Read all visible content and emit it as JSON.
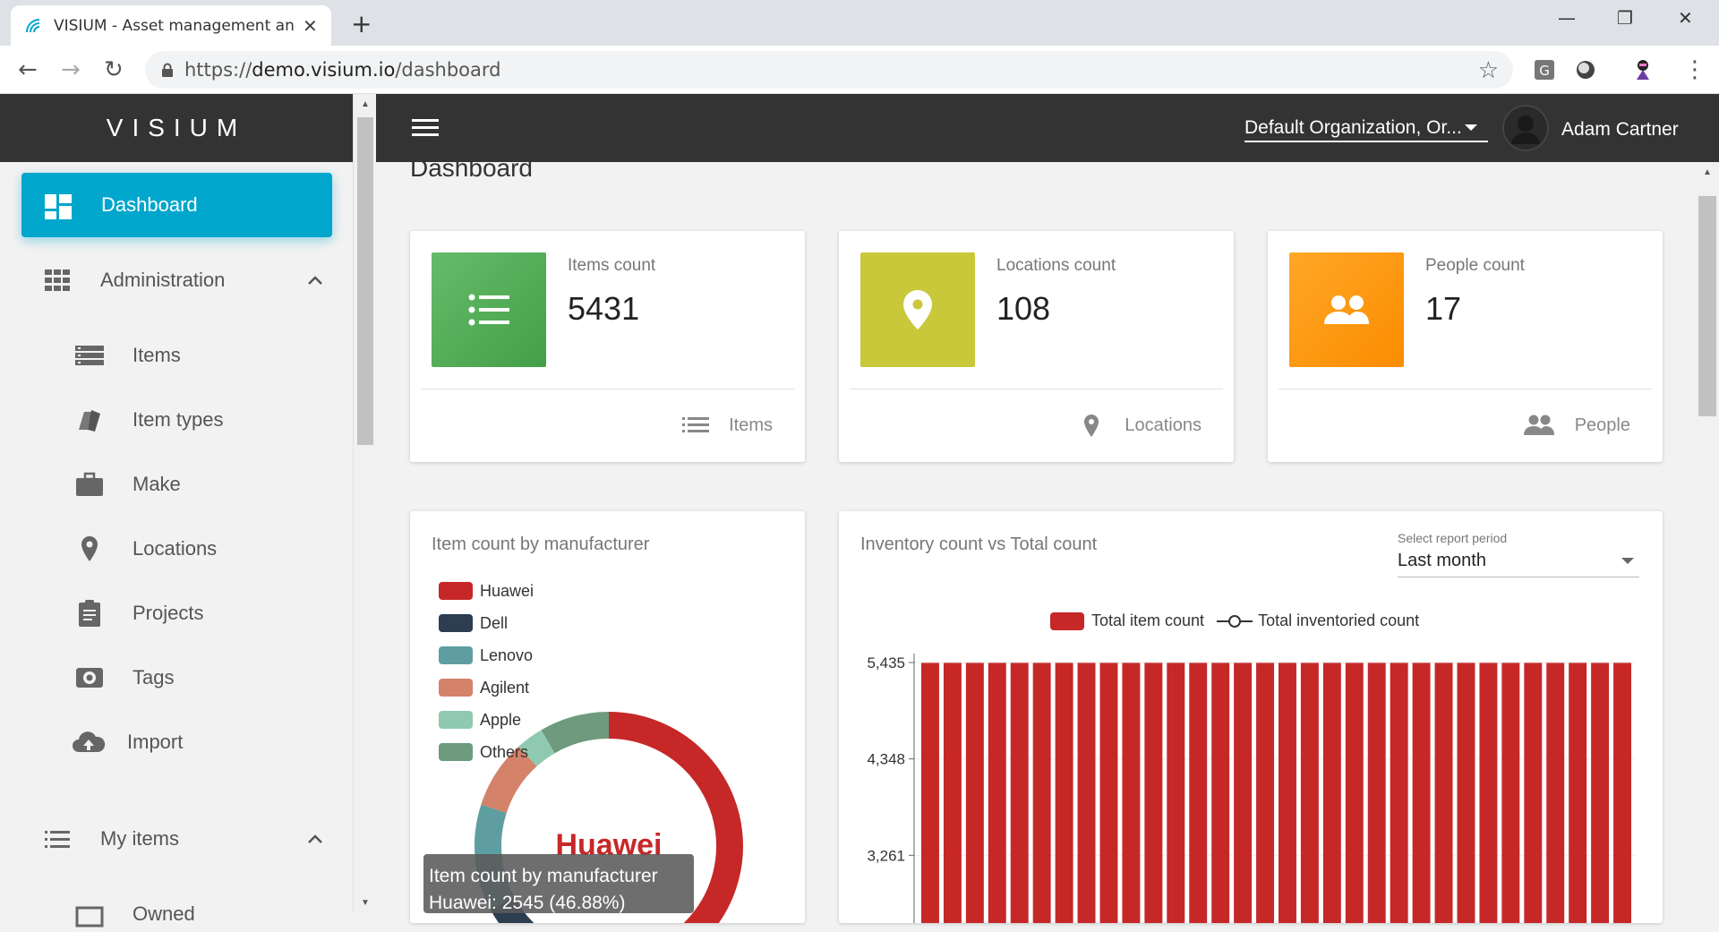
{
  "browser": {
    "tab_title": "VISIUM - Asset management and",
    "url_prefix": "https://",
    "url_host": "demo.visium.io",
    "url_path": "/dashboard"
  },
  "app": {
    "brand": "VISIUM",
    "organization": "Default Organization, Or...",
    "user_name": "Adam Cartner",
    "page_title": "Dashboard"
  },
  "sidebar": {
    "dashboard": "Dashboard",
    "administration": "Administration",
    "admin_items": [
      {
        "label": "Items",
        "icon": "items-list-icon"
      },
      {
        "label": "Item types",
        "icon": "tags-icon"
      },
      {
        "label": "Make",
        "icon": "briefcase-icon"
      },
      {
        "label": "Locations",
        "icon": "location-pin-icon"
      },
      {
        "label": "Projects",
        "icon": "clipboard-icon"
      },
      {
        "label": "Tags",
        "icon": "rfid-tag-icon"
      },
      {
        "label": "Import",
        "icon": "cloud-upload-icon"
      }
    ],
    "my_items": "My items",
    "my_items_children": [
      {
        "label": "Owned",
        "icon": "owned-icon"
      }
    ]
  },
  "stats": [
    {
      "label": "Items count",
      "value": "5431",
      "footer": "Items",
      "color": "#4caf50",
      "icon": "list-icon"
    },
    {
      "label": "Locations count",
      "value": "108",
      "footer": "Locations",
      "color": "#c0ca33",
      "icon": "location-pin-icon"
    },
    {
      "label": "People count",
      "value": "17",
      "footer": "People",
      "color": "#ff9800",
      "icon": "people-icon"
    }
  ],
  "manufacturer_card": {
    "title": "Item count by manufacturer",
    "center_label": "Huawei",
    "tooltip_title": "Item count by manufacturer",
    "tooltip_value": "Huawei: 2545 (46.88%)"
  },
  "inventory_card": {
    "title": "Inventory count vs Total count",
    "period_label": "Select report period",
    "period_value": "Last month",
    "legend_total": "Total item count",
    "legend_inventoried": "Total inventoried count"
  },
  "chart_data": [
    {
      "type": "pie",
      "title": "Item count by manufacturer",
      "categories": [
        "Huawei",
        "Dell",
        "Lenovo",
        "Agilent",
        "Apple",
        "Others"
      ],
      "values": [
        2545,
        1100,
        700,
        450,
        180,
        456
      ],
      "colors": [
        "#c62828",
        "#2c3e50",
        "#5f9ea0",
        "#d4826a",
        "#8fc9b1",
        "#6e9a7e"
      ]
    },
    {
      "type": "bar",
      "title": "Inventory count vs Total count",
      "series": [
        {
          "name": "Total item count",
          "values": [
            5431,
            5431,
            5431,
            5431,
            5431,
            5431,
            5431,
            5431,
            5431,
            5431,
            5431,
            5431,
            5431,
            5431,
            5431,
            5431,
            5431,
            5431,
            5431,
            5431,
            5431,
            5431,
            5431,
            5431,
            5431,
            5431,
            5431,
            5431,
            5431,
            5431,
            5431,
            5431
          ]
        },
        {
          "name": "Total inventoried count",
          "values": []
        }
      ],
      "yticks": [
        "5,435",
        "4,348",
        "3,261"
      ],
      "ylim": [
        2800,
        5435
      ],
      "color": "#c62828"
    }
  ]
}
